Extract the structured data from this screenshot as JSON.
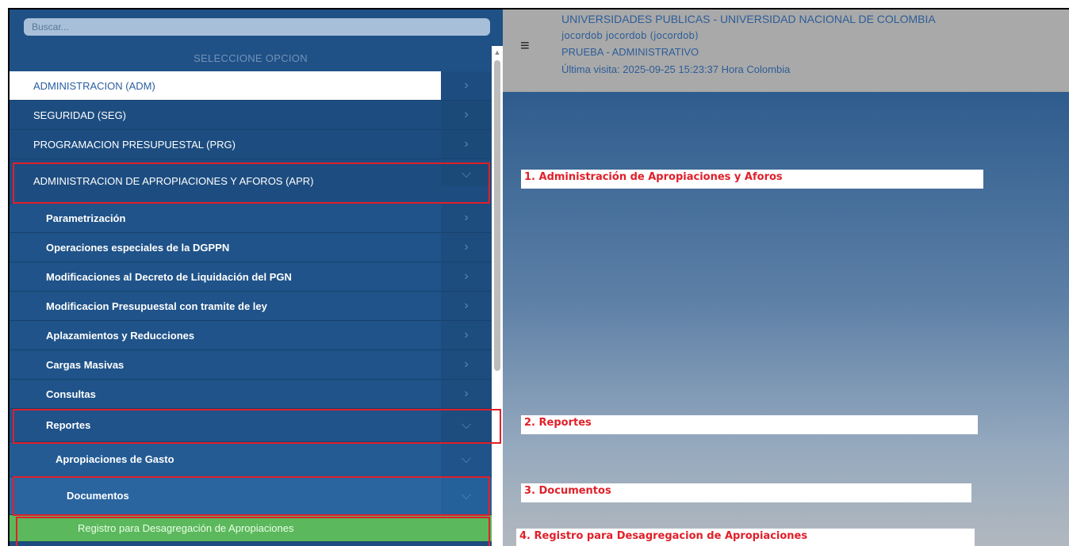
{
  "search": {
    "placeholder": "Buscar..."
  },
  "sidebar": {
    "header": "SELECCIONE OPCION",
    "top_items": [
      {
        "label": "ADMINISTRACION (ADM)",
        "chevron": "chevron-right-icon"
      },
      {
        "label": "SEGURIDAD (SEG)",
        "chevron": "chevron-right-icon"
      },
      {
        "label": "PROGRAMACION PRESUPUESTAL (PRG)",
        "chevron": "chevron-right-icon"
      },
      {
        "label": "ADMINISTRACION DE APROPIACIONES Y AFOROS (APR)",
        "chevron": "chevron-down-icon"
      }
    ],
    "sub_items": [
      {
        "label": "Parametrización"
      },
      {
        "label": "Operaciones especiales de la DGPPN"
      },
      {
        "label": "Modificaciones al Decreto de Liquidación del PGN"
      },
      {
        "label": "Modificacion Presupuestal con tramite de ley"
      },
      {
        "label": "Aplazamientos y Reducciones"
      },
      {
        "label": "Cargas Masivas"
      },
      {
        "label": "Consultas"
      },
      {
        "label": "Reportes"
      }
    ],
    "sub2_item": {
      "label": "Apropiaciones de Gasto"
    },
    "sub3_item": {
      "label": "Documentos"
    },
    "leaf_item": {
      "label": "Registro para Desagregación de Apropiaciones"
    }
  },
  "header": {
    "entity": "UNIVERSIDADES PUBLICAS - UNIVERSIDAD NACIONAL DE COLOMBIA",
    "user": "jocordob jocordob (jocordob)",
    "profile": "PRUEBA - ADMINISTRATIVO",
    "last_visit": "Última visita: 2025-09-25 15:23:37 Hora Colombia"
  },
  "annotations": [
    "1. Administración de Apropiaciones y Aforos",
    "2. Reportes",
    "3. Documentos",
    "4. Registro para Desagregacion de Apropiaciones"
  ],
  "colors": {
    "sidebar_bg": "#1d4d80",
    "active_item_bg": "#ffffff",
    "leaf_green": "#5cb85c",
    "highlight_red": "#e0202a",
    "header_bg": "#a9a9a9"
  }
}
